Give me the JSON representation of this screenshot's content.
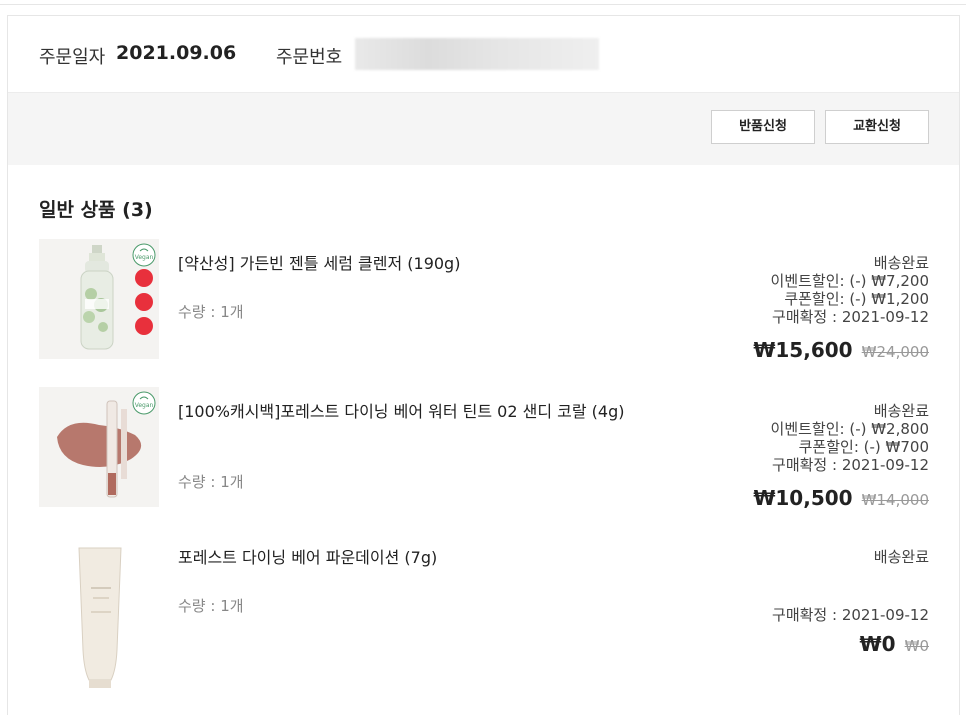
{
  "order": {
    "date_label": "주문일자",
    "date_value": "2021.09.06",
    "number_label": "주문번호"
  },
  "actions": {
    "return_label": "반품신청",
    "exchange_label": "교환신청"
  },
  "section": {
    "title": "일반 상품 (3)"
  },
  "items": [
    {
      "name": "[약산성] 가든빈 젠틀 세럼 클렌저 (190g)",
      "qty": "수량 : 1개",
      "status": "배송완료",
      "event_discount": "이벤트할인: (-) ₩7,200",
      "coupon_discount": "쿠폰할인: (-) ₩1,200",
      "confirm": "구매확정 : 2021-09-12",
      "price": "₩15,600",
      "original_price": "₩24,000",
      "badge": "Vegan"
    },
    {
      "name": "[100%캐시백]포레스트 다이닝 베어 워터 틴트 02 샌디 코랄 (4g)",
      "qty": "수량 : 1개",
      "status": "배송완료",
      "event_discount": "이벤트할인: (-) ₩2,800",
      "coupon_discount": "쿠폰할인: (-) ₩700",
      "confirm": "구매확정 : 2021-09-12",
      "price": "₩10,500",
      "original_price": "₩14,000",
      "badge": "Vegan"
    },
    {
      "name": "포레스트 다이닝 베어 파운데이션 (7g)",
      "qty": "수량 : 1개",
      "status": "배송완료",
      "confirm": "구매확정 : 2021-09-12",
      "price": "₩0",
      "original_price": "₩0"
    }
  ],
  "colors": {
    "badge_red": "#e8303c",
    "vegan_green": "#4a9a6a",
    "tint_color": "#b06a5e"
  }
}
